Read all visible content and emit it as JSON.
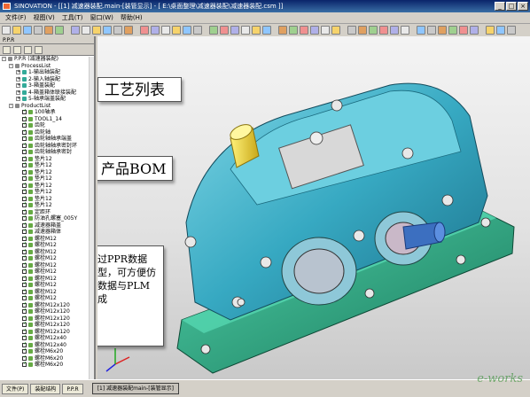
{
  "window": {
    "title": "SINOVATION - [[1] 减速器装配.main-[装管显示] - [ E:\\桌面整理\\减速器装配\\减速器装配.csm ]]",
    "buttons": [
      "_",
      "□",
      "×"
    ]
  },
  "menu": {
    "items": [
      "文件(F)",
      "视图(V)",
      "工具(T)",
      "窗口(W)",
      "帮助(H)"
    ]
  },
  "panel": {
    "header": "P.P.R",
    "tools": [
      "folder-icon",
      "save-icon",
      "flag-icon",
      "pin-icon"
    ]
  },
  "tree": {
    "root": "P.P.R (减速器装配)",
    "process_list": "ProcessList",
    "processes": [
      "1-输出轴装配",
      "2-输入轴装配",
      "3-箱盖装配",
      "4-箱盖箱体联接装配",
      "5-轴承端盖装配"
    ],
    "product_list": "ProductList",
    "products": [
      "100轴承",
      "TOOL1_14",
      "齿轮",
      "齿轮轴",
      "齿轮轴轴承端盖",
      "齿轮轴轴承密封环",
      "齿轮轴轴承密封",
      "垫片12",
      "垫片12",
      "垫片12",
      "垫片12",
      "垫片12",
      "垫片12",
      "垫片12",
      "垫片12",
      "定距环",
      "防油孔螺塞_005Y",
      "减速器箱盖",
      "减速器箱体",
      "螺栓M12",
      "螺栓M12",
      "螺栓M12",
      "螺栓M12",
      "螺栓M12",
      "螺栓M12",
      "螺栓M12",
      "螺栓M12",
      "螺栓M12",
      "螺栓M12",
      "螺栓M12x120",
      "螺栓M12x120",
      "螺栓M12x120",
      "螺栓M12x120",
      "螺栓M12x120",
      "螺栓M12x40",
      "螺栓M12x40",
      "螺栓M6x20",
      "螺栓M6x20",
      "螺栓M6x20"
    ]
  },
  "callouts": {
    "process": "工艺列表",
    "product": "产品BOM",
    "ppr": "通过PPR数据模型，可方便仿真数据与PLM集成"
  },
  "status": {
    "tabs": [
      "文件(P)",
      "装配结构",
      "P.P.R"
    ],
    "document": "[1] 减速器装配main-[装管显示]"
  },
  "watermark": "e-works",
  "colors": {
    "housing": "#3fb3c8",
    "base": "#2fa58c",
    "shaft": "#e8d23a",
    "title": "#0a246a"
  }
}
